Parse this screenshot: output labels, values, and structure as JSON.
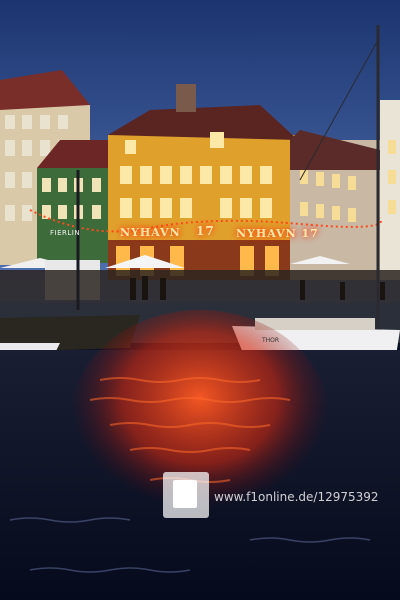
{
  "scene": {
    "description_tag": "nyhavn-canal-evening-photo",
    "signs": {
      "left_sign": "NYHAVN",
      "number_sign": "17",
      "right_sign": "NYHAVN 17",
      "small_sign": "FIERLIN"
    },
    "boat_name": "THOR",
    "watermark_url": "www.f1online.de/12975392"
  },
  "colors": {
    "sky_top": "#1e3a78",
    "sky_bottom": "#4a6fb0",
    "water": "#0c1328",
    "reflection": "#ff3a1a",
    "main_building": "#e0a12c"
  }
}
